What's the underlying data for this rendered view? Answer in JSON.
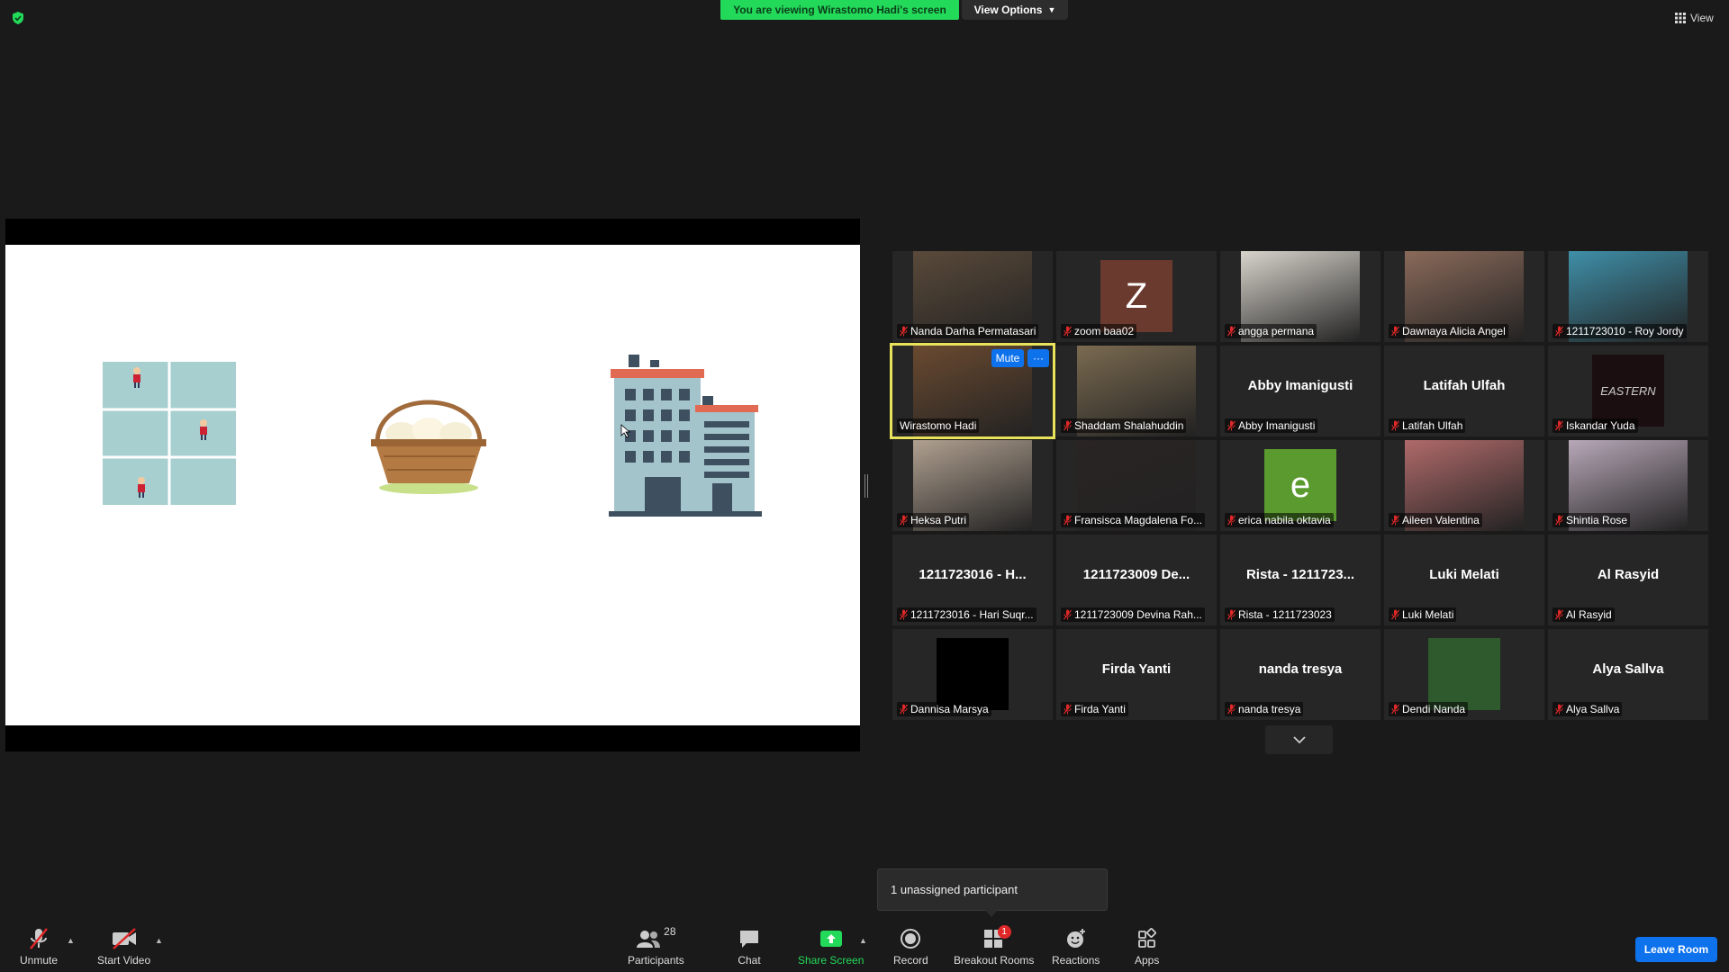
{
  "top": {
    "viewing_banner": "You are viewing Wirastomo Hadi's screen",
    "view_options": "View Options",
    "view": "View"
  },
  "colors": {
    "accent": "#0e72ed",
    "green": "#23d959",
    "active_border": "#e8e35a",
    "mic_muted": "#e02828"
  },
  "participants": [
    {
      "name": "Nanda Darha Permatasari",
      "type": "video",
      "color": "#5a4a3a"
    },
    {
      "name": "zoom baa02",
      "type": "initial",
      "initial": "Z",
      "color": "#6b3a2e"
    },
    {
      "name": "angga permana",
      "type": "video",
      "color": "#d8d4cc"
    },
    {
      "name": "Dawnaya Alicia Angel",
      "type": "video",
      "color": "#8a6a5a"
    },
    {
      "name": "1211723010 - Roy Jordy",
      "type": "video",
      "color": "#3f8fa8"
    },
    {
      "name": "Wirastomo Hadi",
      "type": "video",
      "color": "#6a4a30"
    },
    {
      "name": "Shaddam Shalahuddin",
      "type": "video",
      "color": "#7a6a50"
    },
    {
      "name": "Abby Imanigusti",
      "type": "text",
      "big": "Abby Imanigusti"
    },
    {
      "name": "Latifah Ulfah",
      "type": "text",
      "big": "Latifah Ulfah"
    },
    {
      "name": "Iskandar Yuda",
      "type": "image",
      "image_text": "EASTERN",
      "color": "#1a0e10"
    },
    {
      "name": "Heksa Putri",
      "type": "video",
      "color": "#b0a090"
    },
    {
      "name": "Fransisca Magdalena Fo...",
      "type": "video",
      "color": "#2a2424"
    },
    {
      "name": "erica nabila oktavia",
      "type": "initial",
      "initial": "e",
      "color": "#5a9a2e"
    },
    {
      "name": "Aileen Valentina",
      "type": "video",
      "color": "#b06a6a"
    },
    {
      "name": "Shintia Rose",
      "type": "video",
      "color": "#b8a8b8"
    },
    {
      "name": "1211723016 - Hari Suqr...",
      "type": "text",
      "big": "1211723016 - H..."
    },
    {
      "name": "1211723009 Devina Rah...",
      "type": "text",
      "big": "1211723009 De..."
    },
    {
      "name": "Rista - 1211723023",
      "type": "text",
      "big": "Rista - 1211723..."
    },
    {
      "name": "Luki Melati",
      "type": "text",
      "big": "Luki Melati"
    },
    {
      "name": "Al Rasyid",
      "type": "text",
      "big": "Al Rasyid"
    },
    {
      "name": "Dannisa Marsya",
      "type": "image",
      "image_text": "",
      "color": "#000000"
    },
    {
      "name": "Firda Yanti",
      "type": "text",
      "big": "Firda Yanti"
    },
    {
      "name": "nanda tresya",
      "type": "text",
      "big": "nanda tresya"
    },
    {
      "name": "Dendi Nanda",
      "type": "image",
      "image_text": "",
      "color": "#2e5a2e"
    },
    {
      "name": "Alya Sallva",
      "type": "text",
      "big": "Alya Sallva"
    }
  ],
  "active_tile": {
    "mute_label": "Mute",
    "more_label": "···"
  },
  "tooltip": "1 unassigned participant",
  "toolbar": {
    "unmute": "Unmute",
    "start_video": "Start Video",
    "participants": "Participants",
    "participants_count": "28",
    "chat": "Chat",
    "share_screen": "Share Screen",
    "record": "Record",
    "breakout_rooms": "Breakout Rooms",
    "breakout_badge": "1",
    "reactions": "Reactions",
    "apps": "Apps",
    "leave_room": "Leave Room"
  }
}
